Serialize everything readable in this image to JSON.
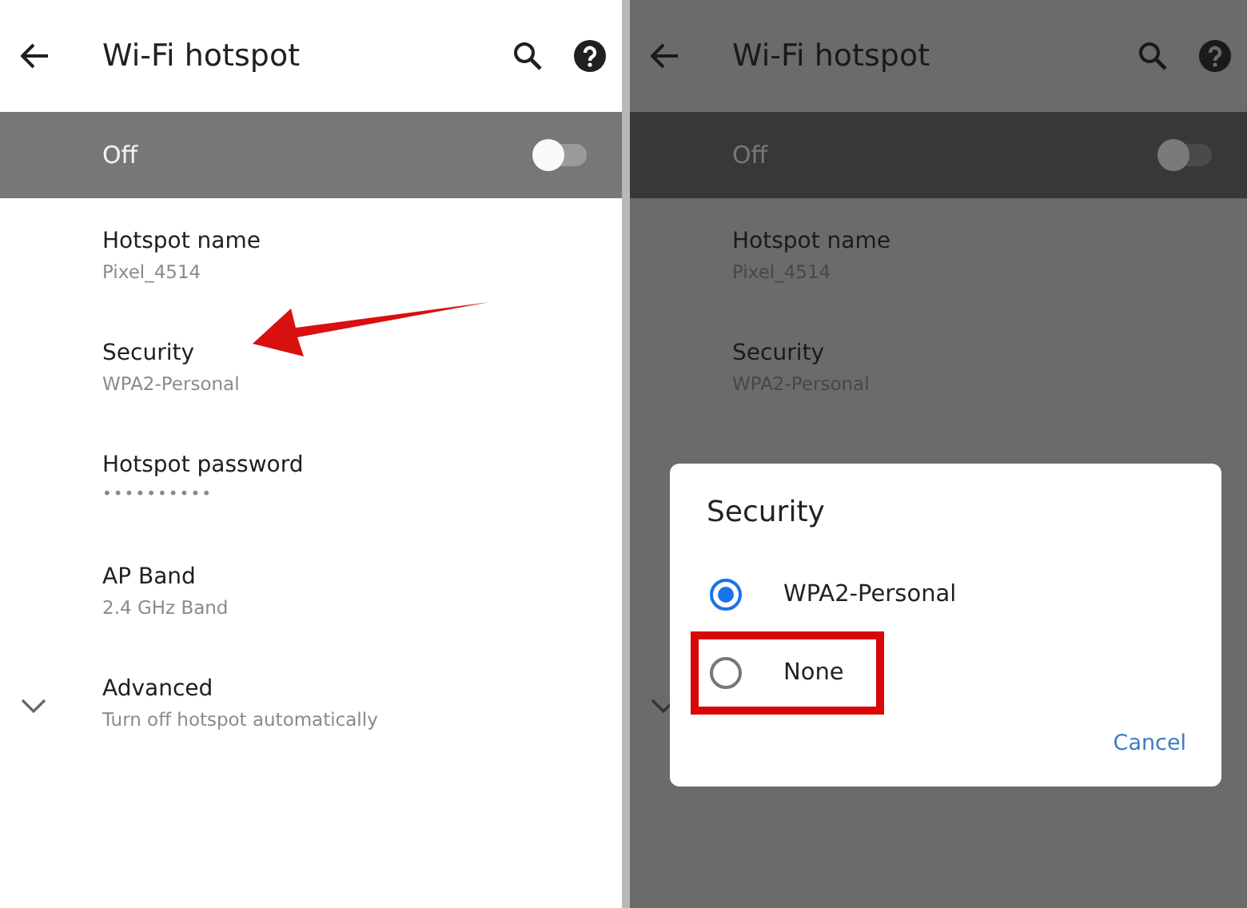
{
  "screens": [
    {
      "dimmed": false,
      "title": "Wi-Fi hotspot",
      "master": {
        "label": "Off",
        "on": false
      },
      "items": [
        {
          "kind": "text",
          "title": "Hotspot name",
          "subtitle": "Pixel_4514",
          "pointed": false
        },
        {
          "kind": "text",
          "title": "Security",
          "subtitle": "WPA2-Personal",
          "pointed": true
        },
        {
          "kind": "password",
          "title": "Hotspot password",
          "subtitle": "••••••••••",
          "pointed": false
        },
        {
          "kind": "text",
          "title": "AP Band",
          "subtitle": "2.4 GHz Band",
          "pointed": false
        },
        {
          "kind": "expandable",
          "title": "Advanced",
          "subtitle": "Turn off hotspot automatically",
          "pointed": false
        }
      ]
    },
    {
      "dimmed": true,
      "title": "Wi-Fi hotspot",
      "master": {
        "label": "Off",
        "on": false
      },
      "items": [
        {
          "kind": "text",
          "title": "Hotspot name",
          "subtitle": "Pixel_4514",
          "pointed": false
        },
        {
          "kind": "text",
          "title": "Security",
          "subtitle": "WPA2-Personal",
          "pointed": false
        },
        {
          "kind": "spacer"
        },
        {
          "kind": "spacer"
        },
        {
          "kind": "expandable"
        }
      ],
      "dialog": {
        "title": "Security",
        "options": [
          {
            "label": "WPA2-Personal",
            "selected": true,
            "highlighted": false
          },
          {
            "label": "None",
            "selected": false,
            "highlighted": true
          }
        ],
        "button": "Cancel"
      }
    }
  ]
}
